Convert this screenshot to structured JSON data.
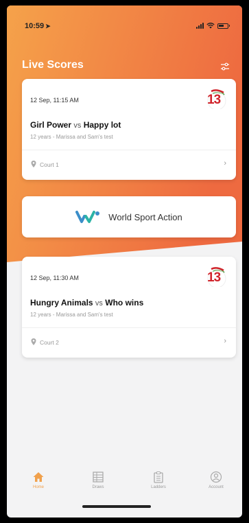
{
  "status_bar": {
    "time": "10:59",
    "location_arrow": "➤"
  },
  "header": {
    "title": "Live Scores",
    "filter_icon": "filter-sliders-icon"
  },
  "colors": {
    "accent": "#f0a04b",
    "gradient_start": "#f5a24a",
    "gradient_end": "#ee6a40",
    "brand_red": "#d0242b"
  },
  "matches": [
    {
      "datetime": "12 Sep, 11:15 AM",
      "team1": "Girl Power",
      "vs": "vs",
      "team2": "Happy lot",
      "division": "12 years - Marissa and Sam's test",
      "court": "Court 1",
      "logo_text": "13"
    },
    {
      "datetime": "12 Sep, 11:30 AM",
      "team1": "Hungry Animals",
      "vs": "vs",
      "team2": "Who wins",
      "division": "12 years - Marissa and Sam's test",
      "court": "Court 2",
      "logo_text": "13"
    }
  ],
  "sponsor": {
    "name": "World Sport Action"
  },
  "tabs": [
    {
      "label": "Home",
      "icon": "home-icon",
      "active": true
    },
    {
      "label": "Draws",
      "icon": "draws-icon",
      "active": false
    },
    {
      "label": "Ladders",
      "icon": "ladders-icon",
      "active": false
    },
    {
      "label": "Account",
      "icon": "account-icon",
      "active": false
    }
  ]
}
